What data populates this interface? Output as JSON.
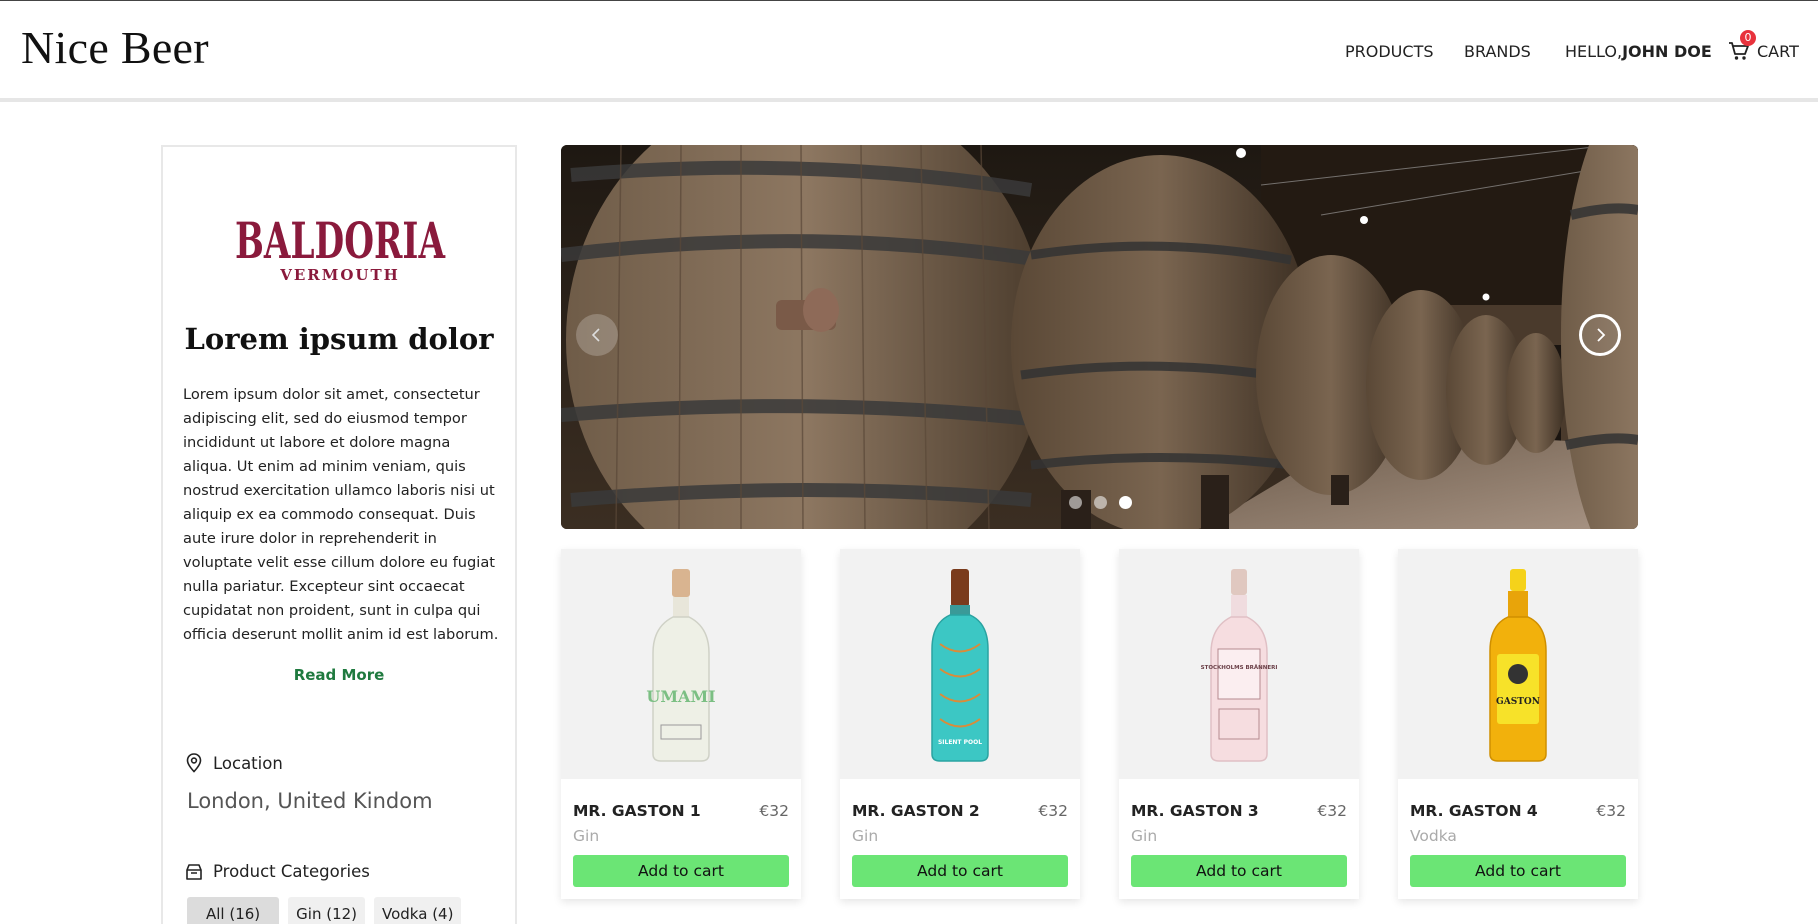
{
  "header": {
    "logo": "Nice Beer",
    "nav": {
      "products": "PRODUCTS",
      "brands": "BRANDS",
      "hello_prefix": "HELLO, ",
      "user_name": "JOHN DOE",
      "cart_label": "CART",
      "cart_count": "0"
    }
  },
  "brand": {
    "logo_text": "BALDORIA",
    "logo_subtext": "VERMOUTH",
    "title": "Lorem ipsum dolor",
    "description": "Lorem ipsum dolor sit amet, consectetur adipiscing elit, sed do eiusmod tempor incididunt ut labore et dolore magna aliqua. Ut enim ad minim veniam, quis nostrud exercitation ullamco laboris nisi ut aliquip ex ea commodo consequat. Duis aute irure dolor in reprehenderit in voluptate velit esse cillum dolore eu fugiat nulla pariatur. Excepteur sint occaecat cupidatat non proident, sunt in culpa qui officia deserunt mollit anim id est laborum.",
    "read_more": "Read More",
    "location_label": "Location",
    "location_value": "London, United Kindom",
    "categories_label": "Product Categories",
    "categories": [
      {
        "label": "All (16)",
        "active": true
      },
      {
        "label": "Gin (12)",
        "active": false
      },
      {
        "label": "Vodka (4)",
        "active": false
      }
    ]
  },
  "carousel": {
    "slide_count": 3,
    "active_slide": 3
  },
  "products": [
    {
      "name": "MR. GASTON 1",
      "price": "€32",
      "category": "Gin",
      "button": "Add to cart",
      "bottle_label": "UMAMI",
      "bottle_color": "#eef0e6"
    },
    {
      "name": "MR. GASTON 2",
      "price": "€32",
      "category": "Gin",
      "button": "Add to cart",
      "bottle_label": "SILENT POOL",
      "bottle_color": "#3cc7c4"
    },
    {
      "name": "MR. GASTON 3",
      "price": "€32",
      "category": "Gin",
      "button": "Add to cart",
      "bottle_label": "STOCKHOLMS BRÄNNERI",
      "bottle_color": "#f6dde0"
    },
    {
      "name": "MR. GASTON 4",
      "price": "€32",
      "category": "Vodka",
      "button": "Add to cart",
      "bottle_label": "GASTON",
      "bottle_color": "#f2b10c"
    }
  ],
  "colors": {
    "brand_logo": "#8a1a3c",
    "read_more": "#1f7a3f",
    "add_to_cart": "#6be575",
    "cart_badge": "#e8323c"
  }
}
